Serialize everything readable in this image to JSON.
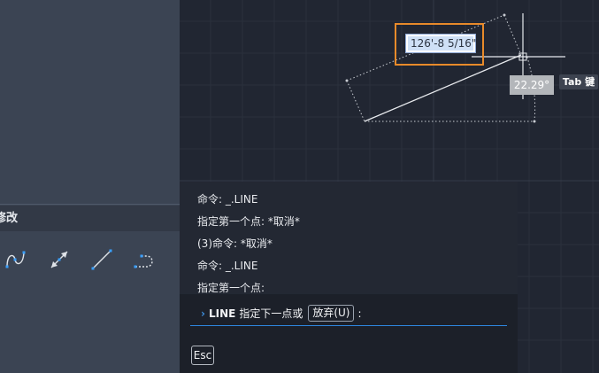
{
  "ribbon": {
    "panel_title": "修改",
    "tools": [
      {
        "icon": "spline-icon"
      },
      {
        "icon": "stretch-arrow-icon"
      },
      {
        "icon": "line-icon"
      },
      {
        "icon": "polyline-arc-icon"
      }
    ]
  },
  "drawing": {
    "dimension_input": "126'-8 5/16\"",
    "angle_value": "22.29°",
    "tab_hint": "Tab 键",
    "highlight_color": "#e88a2a"
  },
  "command_history": [
    "命令: _.LINE",
    "指定第一个点: *取消*",
    "(3)命令: *取消*",
    "命令: _.LINE",
    "指定第一个点:"
  ],
  "command_line": {
    "keyword": "LINE",
    "prompt": "指定下一点或",
    "option": "放弃(U)",
    "suffix": ":",
    "esc_label": "Esc",
    "accent_color": "#2e86de"
  }
}
